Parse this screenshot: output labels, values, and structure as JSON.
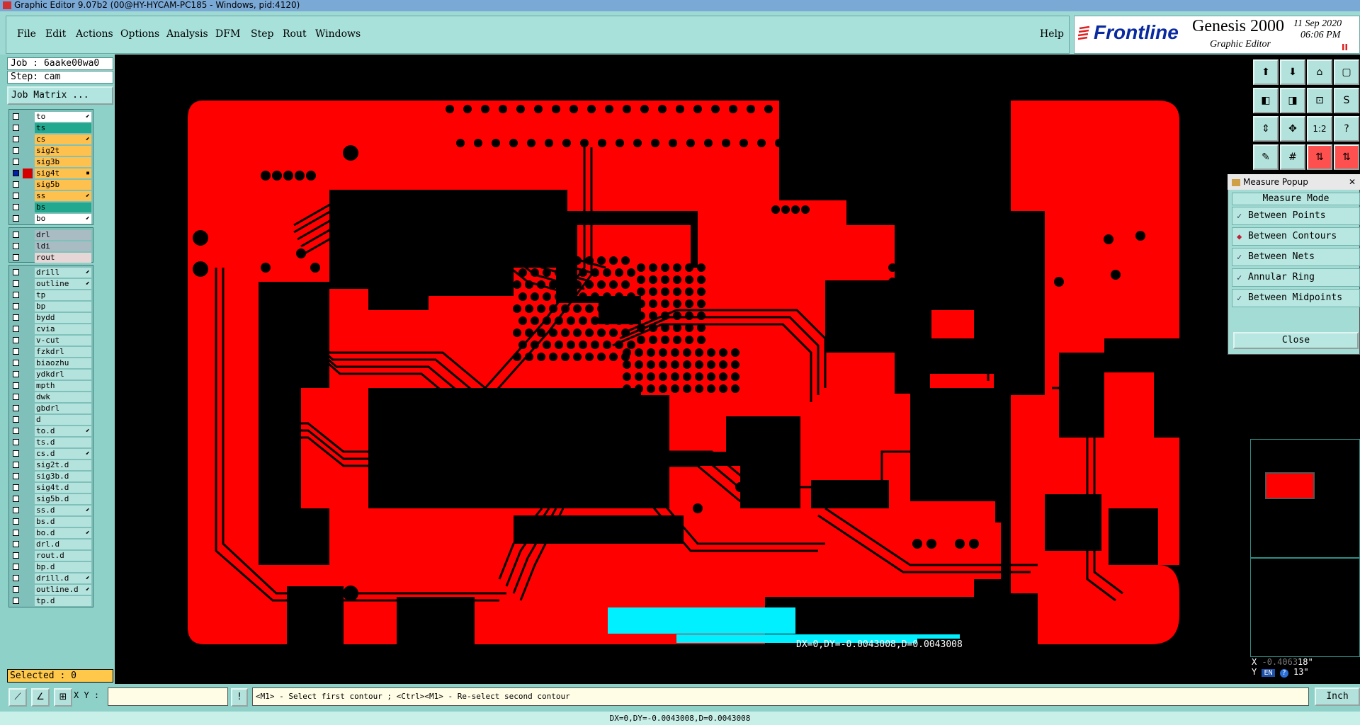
{
  "titlebar": {
    "title": "Graphic Editor 9.07b2 (00@HY-HYCAM-PC185 - Windows, pid:4120)"
  },
  "menu": {
    "items": [
      "File",
      "Edit",
      "Actions",
      "Options",
      "Analysis",
      "DFM",
      "Step",
      "Rout",
      "Windows"
    ],
    "help": "Help"
  },
  "branding": {
    "frontline": "Frontline",
    "genesis": "Genesis 2000",
    "subtitle": "Graphic Editor",
    "date": "11 Sep 2020",
    "time": "06:06 PM"
  },
  "job": {
    "label": "Job : 6aake00wa0",
    "step": "Step: cam",
    "matrix_button": "Job Matrix ..."
  },
  "layers_board": [
    {
      "name": "to",
      "color": "#ffffff",
      "arrow": "⬋"
    },
    {
      "name": "ts",
      "color": "#21a88e",
      "arrow": ""
    },
    {
      "name": "cs",
      "color": "#ffc14d",
      "arrow": "⬋"
    },
    {
      "name": "sig2t",
      "color": "#ffc14d",
      "arrow": ""
    },
    {
      "name": "sig3b",
      "color": "#ffc14d",
      "arrow": ""
    },
    {
      "name": "sig4t",
      "color": "#ffc14d",
      "arrow": "▪"
    },
    {
      "name": "sig5b",
      "color": "#ffc14d",
      "arrow": ""
    },
    {
      "name": "ss",
      "color": "#ffc14d",
      "arrow": "⬋"
    },
    {
      "name": "bs",
      "color": "#21a88e",
      "arrow": ""
    },
    {
      "name": "bo",
      "color": "#ffffff",
      "arrow": "⬋"
    }
  ],
  "layers_drill": [
    {
      "name": "drl",
      "color": "#a9bcc4",
      "arrow": ""
    },
    {
      "name": "ldi",
      "color": "#a9bcc4",
      "arrow": ""
    },
    {
      "name": "rout",
      "color": "#e7d6d6",
      "arrow": ""
    }
  ],
  "layers_misc": [
    {
      "name": "drill",
      "arrow": "⬋"
    },
    {
      "name": "outline",
      "arrow": "⬋"
    },
    {
      "name": "tp",
      "arrow": ""
    },
    {
      "name": "bp",
      "arrow": ""
    },
    {
      "name": "bydd",
      "arrow": ""
    },
    {
      "name": "cvia",
      "arrow": ""
    },
    {
      "name": "v-cut",
      "arrow": ""
    },
    {
      "name": "fzkdrl",
      "arrow": ""
    },
    {
      "name": "biaozhu",
      "arrow": ""
    },
    {
      "name": "ydkdrl",
      "arrow": ""
    },
    {
      "name": "mpth",
      "arrow": ""
    },
    {
      "name": "dwk",
      "arrow": ""
    },
    {
      "name": "gbdrl",
      "arrow": ""
    },
    {
      "name": "d",
      "arrow": ""
    },
    {
      "name": "to.d",
      "arrow": "⬋"
    },
    {
      "name": "ts.d",
      "arrow": ""
    },
    {
      "name": "cs.d",
      "arrow": "⬋"
    },
    {
      "name": "sig2t.d",
      "arrow": ""
    },
    {
      "name": "sig3b.d",
      "arrow": ""
    },
    {
      "name": "sig4t.d",
      "arrow": ""
    },
    {
      "name": "sig5b.d",
      "arrow": ""
    },
    {
      "name": "ss.d",
      "arrow": "⬋"
    },
    {
      "name": "bs.d",
      "arrow": ""
    },
    {
      "name": "bo.d",
      "arrow": "⬋"
    },
    {
      "name": "drl.d",
      "arrow": ""
    },
    {
      "name": "rout.d",
      "arrow": ""
    },
    {
      "name": "bp.d",
      "arrow": ""
    },
    {
      "name": "drill.d",
      "arrow": "⬋"
    },
    {
      "name": "outline.d",
      "arrow": "⬋"
    },
    {
      "name": "tp.d",
      "arrow": ""
    }
  ],
  "layer_misc_color": "#b4e2dc",
  "work_layer_color": "#d40000",
  "selected": "Selected : 0",
  "measure": {
    "title": "Measure Popup",
    "mode_label": "Measure Mode",
    "options": [
      "Between Points",
      "Between Contours",
      "Between Nets",
      "Annular Ring",
      "Between Midpoints"
    ],
    "active_index": 1,
    "close": "Close"
  },
  "tools": [
    {
      "icon": "layer-up-icon",
      "glyph": "⬆"
    },
    {
      "icon": "layer-down-icon",
      "glyph": "⬇"
    },
    {
      "icon": "home-icon",
      "glyph": "⌂"
    },
    {
      "icon": "window-icon",
      "glyph": "▢"
    },
    {
      "icon": "pan-left-icon",
      "glyph": "◧"
    },
    {
      "icon": "pan-right-icon",
      "glyph": "◨"
    },
    {
      "icon": "zoom-area-icon",
      "glyph": "⊡"
    },
    {
      "icon": "redraw-icon",
      "glyph": "S"
    },
    {
      "icon": "fit-vertical-icon",
      "glyph": "⇕"
    },
    {
      "icon": "fit-all-icon",
      "glyph": "✥"
    },
    {
      "icon": "scale-1-2-icon",
      "glyph": "1:2"
    },
    {
      "icon": "query-icon",
      "glyph": "?"
    },
    {
      "icon": "snap-icon",
      "glyph": "✎"
    },
    {
      "icon": "grid-icon",
      "glyph": "#"
    },
    {
      "icon": "measure-icon",
      "glyph": "⇅"
    },
    {
      "icon": "net-icon",
      "glyph": "⇅"
    }
  ],
  "coords": {
    "x_label": "X",
    "x_value": "-0.4063",
    "x_tail": "18\"",
    "y_label": "Y",
    "y_tail": "13\"",
    "lang": "EN"
  },
  "bottom": {
    "xy_label": "X Y :",
    "xy_value": "",
    "prompt": "<M1> - Select first contour ; <Ctrl><M1> - Re-select second contour",
    "units": "Inch",
    "measure_readout": "DX=0,DY=-0.0043008,D=0.0043008",
    "status": "DX=0,DY=-0.0043008,D=0.0043008"
  },
  "colors": {
    "copper": "#ff0000",
    "highlight": "#00f0ff",
    "panel": "#8ed1c9"
  }
}
